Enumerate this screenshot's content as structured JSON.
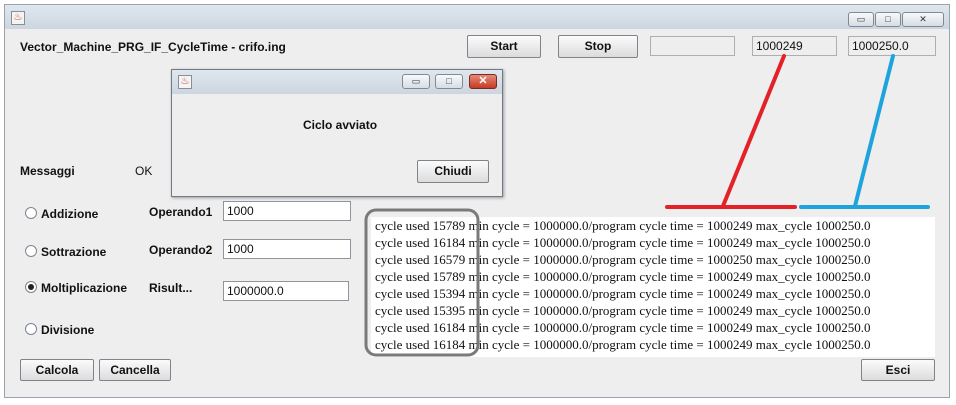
{
  "window": {
    "app_title": "Vector_Machine_PRG_IF_CycleTime - crifo.ing",
    "controls": {
      "minimize": "▭",
      "maximize": "□",
      "close": "✕"
    }
  },
  "toolbar": {
    "start_label": "Start",
    "stop_label": "Stop",
    "status_value": "",
    "cycle_value": "1000249",
    "max_cycle_value": "1000250.0"
  },
  "messages": {
    "label": "Messaggi",
    "value": "OK"
  },
  "operations": {
    "selected": "Moltiplicazione",
    "items": [
      "Addizione",
      "Sottrazione",
      "Moltiplicazione",
      "Divisione"
    ]
  },
  "fields": {
    "operando1_label": "Operando1",
    "operando1_value": "1000",
    "operando2_label": "Operando2",
    "operando2_value": "1000",
    "result_label": "Risult...",
    "result_value": "1000000.0"
  },
  "log_lines": [
    "cycle used 15789 min cycle = 1000000.0/program cycle time = 1000249 max_cycle 1000250.0",
    "cycle used 16184 min cycle = 1000000.0/program cycle time = 1000249 max_cycle 1000250.0",
    "cycle used 16579 min cycle = 1000000.0/program cycle time = 1000250 max_cycle 1000250.0",
    "cycle used 15789 min cycle = 1000000.0/program cycle time = 1000249 max_cycle 1000250.0",
    "cycle used 15394 min cycle = 1000000.0/program cycle time = 1000249 max_cycle 1000250.0",
    "cycle used 15395 min cycle = 1000000.0/program cycle time = 1000249 max_cycle 1000250.0",
    "cycle used 16184 min cycle = 1000000.0/program cycle time = 1000249 max_cycle 1000250.0",
    "cycle used 16184 min cycle = 1000000.0/program cycle time = 1000249 max_cycle 1000250.0"
  ],
  "buttons": {
    "calcola": "Calcola",
    "cancella": "Cancella",
    "esci": "Esci"
  },
  "dialog": {
    "message": "Ciclo avviato",
    "close_label": "Chiudi",
    "close_glyph": "✕"
  },
  "colors": {
    "annotation_red": "#e32227",
    "annotation_blue": "#1fa3dd",
    "annotation_gray": "#7a7a7a"
  }
}
